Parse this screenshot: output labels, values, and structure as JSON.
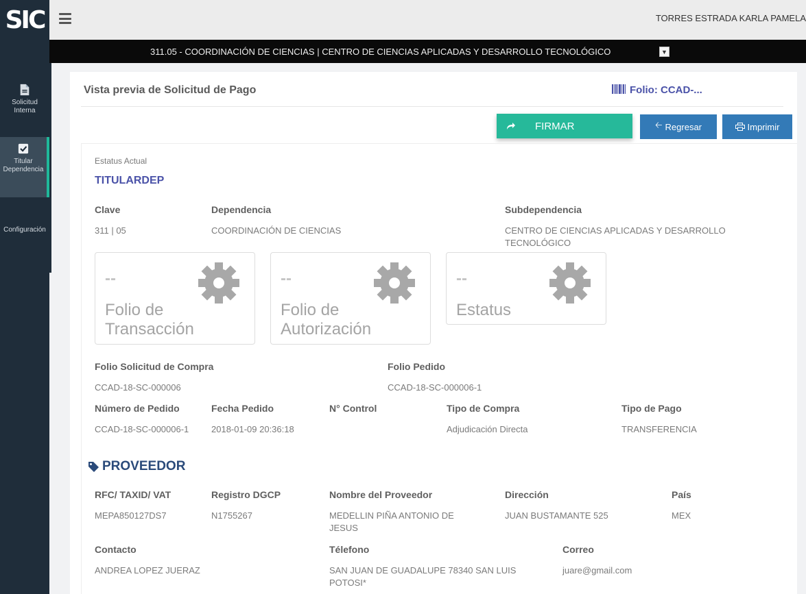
{
  "header": {
    "logo": "SIC",
    "user": "TORRES ESTRADA KARLA PAMELA"
  },
  "org": {
    "selector": "311.05 - COORDINACIÓN DE CIENCIAS | CENTRO DE CIENCIAS APLICADAS Y DESARROLLO TECNOLÓGICO"
  },
  "sidebar": {
    "items": [
      {
        "label": "Solicitud Interna",
        "line1": "Solicitud",
        "line2": "Interna",
        "icon": "document-icon"
      },
      {
        "label": "Titular Dependencia",
        "line1": "Titular",
        "line2": "Dependencia",
        "icon": "checkbox-icon",
        "active": true
      },
      {
        "label": "Configuración",
        "line1": "Configuración",
        "line2": "",
        "icon": ""
      }
    ]
  },
  "page": {
    "title": "Vista previa de Solicitud de Pago",
    "folio": "Folio: CCAD-..."
  },
  "buttons": {
    "firmar": "FIRMAR",
    "regresar": "Regresar",
    "imprimir": "Imprimir"
  },
  "status": {
    "label": "Estatus Actual",
    "value": "TITULARDEP"
  },
  "info": {
    "clave_label": "Clave",
    "clave": "311 | 05",
    "dependencia_label": "Dependencia",
    "dependencia": "COORDINACIÓN DE CIENCIAS",
    "subdependencia_label": "Subdependencia",
    "subdependencia": "CENTRO DE CIENCIAS APLICADAS Y DESARROLLO TECNOLÓGICO"
  },
  "tiles": [
    {
      "value": "--",
      "line1": "Folio de",
      "line2": "Transacción"
    },
    {
      "value": "--",
      "line1": "Folio de",
      "line2": "Autorización"
    },
    {
      "value": "--",
      "line1": "Estatus",
      "line2": ""
    }
  ],
  "compra": {
    "folio_sc_label": "Folio Solicitud de Compra",
    "folio_sc": "CCAD-18-SC-000006",
    "folio_pedido_label": "Folio Pedido",
    "folio_pedido": "CCAD-18-SC-000006-1",
    "numero_pedido_label": "Número de Pedido",
    "numero_pedido": "CCAD-18-SC-000006-1",
    "fecha_pedido_label": "Fecha Pedido",
    "fecha_pedido": "2018-01-09 20:36:18",
    "control_label": "N° Control",
    "control": "",
    "tipo_compra_label": "Tipo de Compra",
    "tipo_compra": "Adjudicación Directa",
    "tipo_pago_label": "Tipo de Pago",
    "tipo_pago": "TRANSFERENCIA"
  },
  "proveedor": {
    "section": "PROVEEDOR",
    "rfc_label": "RFC/ TAXID/ VAT",
    "rfc": "MEPA850127DS7",
    "registro_label": "Registro DGCP",
    "registro": "N1755267",
    "nombre_label": "Nombre del Proveedor",
    "nombre": "MEDELLIN PIÑA ANTONIO DE JESUS",
    "direccion_label": "Dirección",
    "direccion": "JUAN BUSTAMANTE 525",
    "pais_label": "País",
    "pais": "MEX",
    "contacto_label": "Contacto",
    "contacto": "ANDREA LOPEZ JUERAZ",
    "telefono_label": "Télefono",
    "telefono": "SAN JUAN DE GUADALUPE 78340 SAN LUIS POTOSI*",
    "correo_label": "Correo",
    "correo": "juare@gmail.com"
  },
  "colors": {
    "sidebar": "#1f2d3a",
    "accent_green": "#26b99a",
    "button_blue": "#337ab7",
    "status_purple": "#4a52a8"
  }
}
